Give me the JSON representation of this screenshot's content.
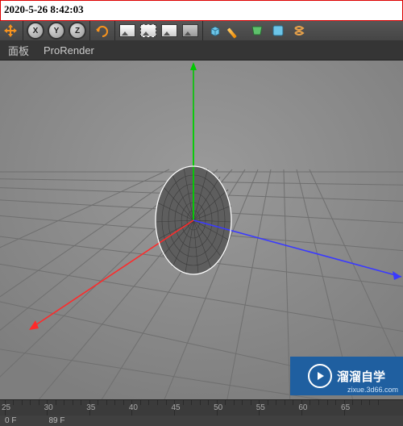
{
  "timestamp": "2020-5-26 8:42:03",
  "toolbar": {
    "axis_x": "X",
    "axis_y": "Y",
    "axis_z": "Z"
  },
  "menu": {
    "panel": "面板",
    "prorender": "ProRender"
  },
  "timeline": {
    "ticks": [
      "25",
      "30",
      "35",
      "40",
      "45",
      "50",
      "55",
      "60",
      "65"
    ]
  },
  "bottombar": {
    "frame_start": "0  F",
    "frame_cur": "89  F"
  },
  "watermark": {
    "title": "溜溜自学",
    "url": "zixue.3d66.com"
  }
}
